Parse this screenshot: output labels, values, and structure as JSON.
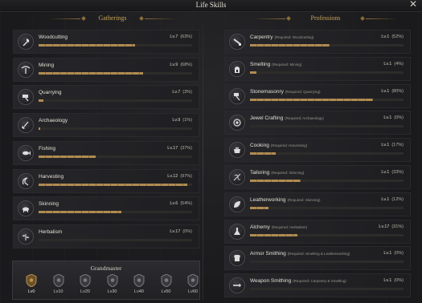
{
  "window": {
    "title": "Life Skills",
    "close_symbol": "✕"
  },
  "gatherings": {
    "header": "Gatherings",
    "skills": [
      {
        "name": "Woodcutting",
        "level": "Lv.7",
        "percent": "(63%)",
        "icon": "axe-icon",
        "progress": 0.63
      },
      {
        "name": "Mining",
        "level": "Lv.9",
        "percent": "(68%)",
        "icon": "pickaxe-icon",
        "progress": 0.68
      },
      {
        "name": "Quarrying",
        "level": "Lv.7",
        "percent": "(3%)",
        "icon": "hammer-icon",
        "progress": 0.03
      },
      {
        "name": "Archaeology",
        "level": "Lv.9",
        "percent": "(1%)",
        "icon": "shovel-icon",
        "progress": 0.01
      },
      {
        "name": "Fishing",
        "level": "Lv.17",
        "percent": "(37%)",
        "icon": "fish-icon",
        "progress": 0.37
      },
      {
        "name": "Harvesting",
        "level": "Lv.12",
        "percent": "(97%)",
        "icon": "sickle-icon",
        "progress": 0.97
      },
      {
        "name": "Skinning",
        "level": "Lv.6",
        "percent": "(54%)",
        "icon": "boar-icon",
        "progress": 0.54
      },
      {
        "name": "Herbalism",
        "level": "Lv.17",
        "percent": "(0%)",
        "icon": "herb-icon",
        "progress": 0.0
      }
    ]
  },
  "professions": {
    "header": "Professions",
    "skills": [
      {
        "name": "Carpentry",
        "req": "(Required: Woodcutting)",
        "level": "Lv.1",
        "percent": "(52%)",
        "icon": "saw-icon",
        "progress": 0.52
      },
      {
        "name": "Smelting",
        "req": "(Required: Mining)",
        "level": "Lv.1",
        "percent": "(4%)",
        "icon": "furnace-icon",
        "progress": 0.04
      },
      {
        "name": "Stonemasonry",
        "req": "(Required: Quarrying)",
        "level": "Lv.1",
        "percent": "(80%)",
        "icon": "mallet-icon",
        "progress": 0.8
      },
      {
        "name": "Jewel Crafting",
        "req": "(Required: Archaeology)",
        "level": "Lv.1",
        "percent": "(0%)",
        "icon": "gem-icon",
        "progress": 0.0
      },
      {
        "name": "Cooking",
        "req": "(Required: Harvesting)",
        "level": "Lv.1",
        "percent": "(17%)",
        "icon": "pot-icon",
        "progress": 0.17
      },
      {
        "name": "Tailoring",
        "req": "(Required: Skinning)",
        "level": "Lv.1",
        "percent": "(33%)",
        "icon": "needle-icon",
        "progress": 0.33
      },
      {
        "name": "Leatherworking",
        "req": "(Required: Skinning)",
        "level": "Lv.1",
        "percent": "(12%)",
        "icon": "leaf-icon",
        "progress": 0.12
      },
      {
        "name": "Alchemy",
        "req": "(Required: Herbalism)",
        "level": "Lv.17",
        "percent": "(31%)",
        "icon": "flask-icon",
        "progress": 0.31
      },
      {
        "name": "Armor Smithing",
        "req": "(Required: Smelting & Leatherworking)",
        "level": "Lv.1",
        "percent": "(0%)",
        "icon": "armor-icon",
        "progress": 0.0
      },
      {
        "name": "Weapon Smithing",
        "req": "(Required: Carpentry & Smelting)",
        "level": "Lv.1",
        "percent": "(0%)",
        "icon": "sword-icon",
        "progress": 0.0
      }
    ]
  },
  "grandmaster": {
    "title": "Grandmaster",
    "tiers": [
      {
        "label": "Lv0",
        "active": true
      },
      {
        "label": "Lv10",
        "active": false
      },
      {
        "label": "Lv20",
        "active": false
      },
      {
        "label": "Lv30",
        "active": false
      },
      {
        "label": "Lv40",
        "active": false
      },
      {
        "label": "Lv50",
        "active": false
      },
      {
        "label": "Lv60",
        "active": false
      }
    ]
  },
  "colors": {
    "accent_gold": "#c9a35a",
    "bar_fill": "#b08b52",
    "bar_track": "#2d2c2a"
  }
}
